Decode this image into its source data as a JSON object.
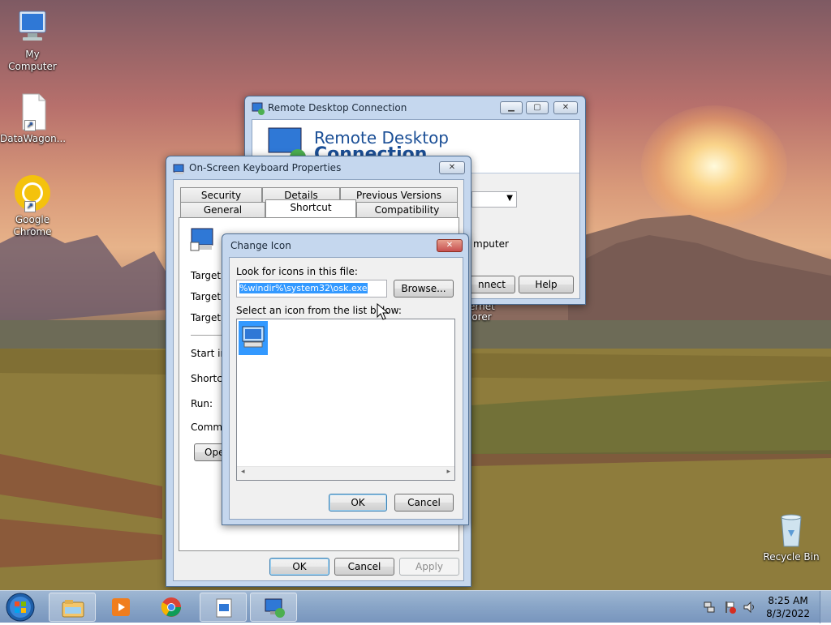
{
  "desktop": {
    "icons": [
      {
        "label": "My Computer",
        "icon": "computer-icon"
      },
      {
        "label": "DataWagon...",
        "icon": "file-shortcut-icon"
      },
      {
        "label": "Google Chrome",
        "icon": "chrome-icon"
      },
      {
        "label": "Recycle Bin",
        "icon": "recycle-bin-icon"
      }
    ],
    "hidden_label_fragment": "ernet\nlorer"
  },
  "rdc_window": {
    "title": "Remote Desktop Connection",
    "banner_line1": "Remote Desktop",
    "banner_line2": "Connection",
    "computer_fragment": "mputer",
    "connect_fragment": "nnect",
    "help_label": "Help"
  },
  "props_window": {
    "title": "On-Screen Keyboard Properties",
    "tabs_row1": [
      "Security",
      "Details",
      "Previous Versions"
    ],
    "tabs_row2": [
      "General",
      "Shortcut",
      "Compatibility"
    ],
    "active_tab": "Shortcut",
    "labels": {
      "target_type": "Target ty",
      "target_location": "Target lo",
      "target": "Target:",
      "start_in": "Start in:",
      "shortcut_key": "Shortcut",
      "run": "Run:",
      "comment": "Commen",
      "open_fragment": "Ope"
    },
    "buttons": {
      "ok": "OK",
      "cancel": "Cancel",
      "apply": "Apply"
    }
  },
  "change_icon_dialog": {
    "title": "Change Icon",
    "look_label": "Look for icons in this file:",
    "path_value": "%windir%\\system32\\osk.exe",
    "browse_label": "Browse...",
    "select_label": "Select an icon from the list below:",
    "ok_label": "OK",
    "cancel_label": "Cancel"
  },
  "taskbar": {
    "time": "8:25 AM",
    "date": "8/3/2022",
    "items": [
      "start-orb",
      "explorer-icon",
      "media-player-icon",
      "chrome-icon",
      "osk-properties-icon",
      "remote-desktop-icon"
    ]
  },
  "colors": {
    "selection": "#3399ff",
    "close_red": "#c75050",
    "window_frame": "#c5d7ee",
    "rdc_title_blue": "#1b4f96"
  }
}
